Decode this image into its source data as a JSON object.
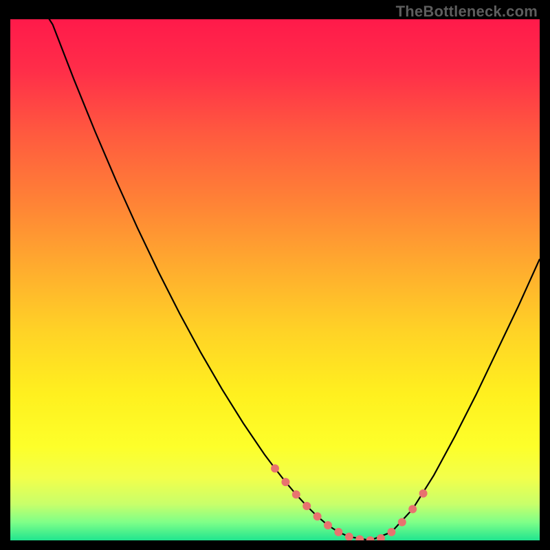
{
  "watermark": "TheBottleneck.com",
  "colors": {
    "curve_stroke": "#000000",
    "marker_fill": "#e8736f",
    "gradient_top": "#ff1a4a",
    "gradient_bottom": "#20e58f"
  },
  "chart_data": {
    "type": "line",
    "title": "",
    "xlabel": "",
    "ylabel": "",
    "xlim": [
      0,
      100
    ],
    "ylim": [
      0,
      100
    ],
    "x": [
      0,
      4,
      8,
      12,
      16,
      20,
      24,
      28,
      32,
      36,
      40,
      44,
      48,
      50,
      52,
      54,
      56,
      58,
      60,
      62,
      64,
      68,
      72,
      76,
      80,
      84,
      88,
      92,
      96,
      100
    ],
    "values": [
      122,
      110,
      99,
      88.5,
      78.5,
      69,
      60,
      51.5,
      43.5,
      36,
      29,
      22.5,
      16.5,
      13.8,
      11.2,
      8.8,
      6.6,
      4.6,
      2.9,
      1.6,
      0.7,
      0,
      1.6,
      6.0,
      12.5,
      20.0,
      28.0,
      36.5,
      45.0,
      54.0
    ],
    "markers_x": [
      50,
      52,
      54,
      56,
      58,
      60,
      62,
      64,
      66,
      68,
      70,
      72,
      74,
      76,
      78
    ],
    "markers_y": [
      13.8,
      11.2,
      8.8,
      6.6,
      4.6,
      2.9,
      1.6,
      0.7,
      0.2,
      0,
      0.4,
      1.6,
      3.5,
      6.0,
      9.0
    ],
    "marker_radius_px": 6
  }
}
